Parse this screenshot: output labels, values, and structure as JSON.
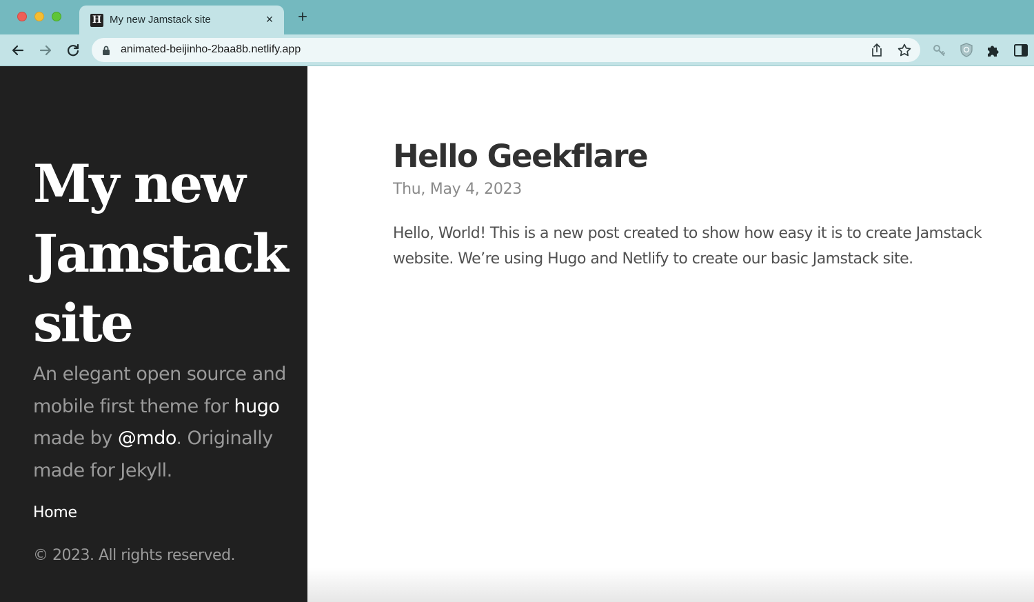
{
  "browser": {
    "tab": {
      "title": "My new Jamstack site",
      "favicon": "H",
      "close": "×"
    },
    "new_tab": "+",
    "url": "animated-beijinho-2baa8b.netlify.app",
    "icons": [
      "back-arrow-icon",
      "forward-arrow-icon",
      "reload-icon",
      "lock-icon",
      "share-icon",
      "star-icon",
      "key-icon",
      "shield-icon",
      "puzzle-icon",
      "side-panel-icon"
    ]
  },
  "sidebar": {
    "title_lines": [
      "My new",
      "Jamstack",
      "site"
    ],
    "lead": {
      "part1": "An elegant open source and mobile first theme for ",
      "link_hugo": "hugo",
      "part2": " made by ",
      "link_mdo": "@mdo",
      "part3": ". Originally made for Jekyll."
    },
    "nav": {
      "home": "Home"
    },
    "copyright": "© 2023. All rights reserved."
  },
  "post": {
    "title": "Hello Geekflare",
    "date": "Thu, May 4, 2023",
    "body": "Hello, World! This is a new post created to show how easy it is to create Jamstack website. We’re using Hugo and Netlify to create our basic Jamstack site."
  },
  "colors": {
    "tabbar": "#74b9bf",
    "toolbar": "#c3e3e6",
    "sidebar_bg": "#202020",
    "sidebar_muted": "#9a9a9a",
    "post_title": "#313131",
    "post_body": "#515151"
  }
}
